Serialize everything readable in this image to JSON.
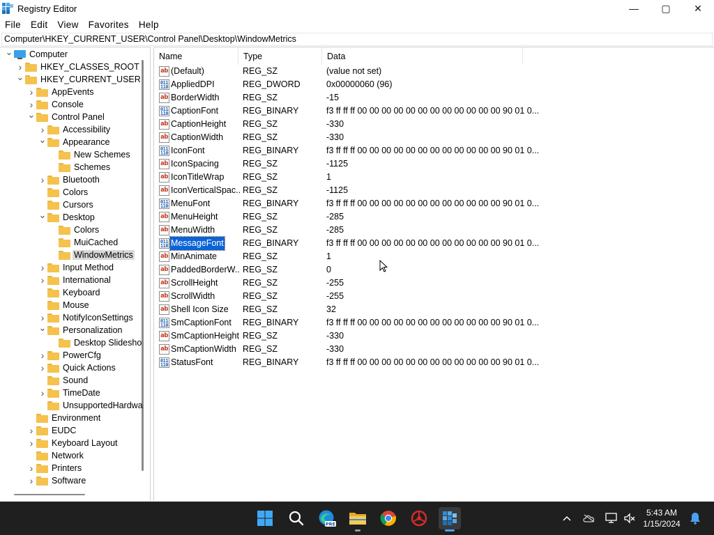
{
  "window": {
    "title": "Registry Editor",
    "controls": {
      "minimize": "—",
      "maximize": "▢",
      "close": "✕"
    }
  },
  "menu": [
    "File",
    "Edit",
    "View",
    "Favorites",
    "Help"
  ],
  "address": "Computer\\HKEY_CURRENT_USER\\Control Panel\\Desktop\\WindowMetrics",
  "tree": [
    {
      "label": "Computer",
      "depth": 0,
      "expander": "expanded",
      "icon": "computer-icon"
    },
    {
      "label": "HKEY_CLASSES_ROOT",
      "depth": 1,
      "expander": "collapsed"
    },
    {
      "label": "HKEY_CURRENT_USER",
      "depth": 1,
      "expander": "expanded"
    },
    {
      "label": "AppEvents",
      "depth": 2,
      "expander": "collapsed"
    },
    {
      "label": "Console",
      "depth": 2,
      "expander": "collapsed"
    },
    {
      "label": "Control Panel",
      "depth": 2,
      "expander": "expanded"
    },
    {
      "label": "Accessibility",
      "depth": 3,
      "expander": "collapsed"
    },
    {
      "label": "Appearance",
      "depth": 3,
      "expander": "expanded"
    },
    {
      "label": "New Schemes",
      "depth": 4,
      "expander": "none"
    },
    {
      "label": "Schemes",
      "depth": 4,
      "expander": "none"
    },
    {
      "label": "Bluetooth",
      "depth": 3,
      "expander": "collapsed"
    },
    {
      "label": "Colors",
      "depth": 3,
      "expander": "none"
    },
    {
      "label": "Cursors",
      "depth": 3,
      "expander": "none"
    },
    {
      "label": "Desktop",
      "depth": 3,
      "expander": "expanded"
    },
    {
      "label": "Colors",
      "depth": 4,
      "expander": "none"
    },
    {
      "label": "MuiCached",
      "depth": 4,
      "expander": "none"
    },
    {
      "label": "WindowMetrics",
      "depth": 4,
      "expander": "none",
      "selected": true
    },
    {
      "label": "Input Method",
      "depth": 3,
      "expander": "collapsed"
    },
    {
      "label": "International",
      "depth": 3,
      "expander": "collapsed"
    },
    {
      "label": "Keyboard",
      "depth": 3,
      "expander": "none"
    },
    {
      "label": "Mouse",
      "depth": 3,
      "expander": "none"
    },
    {
      "label": "NotifyIconSettings",
      "depth": 3,
      "expander": "collapsed"
    },
    {
      "label": "Personalization",
      "depth": 3,
      "expander": "expanded"
    },
    {
      "label": "Desktop Slidesho",
      "depth": 4,
      "expander": "none"
    },
    {
      "label": "PowerCfg",
      "depth": 3,
      "expander": "collapsed"
    },
    {
      "label": "Quick Actions",
      "depth": 3,
      "expander": "collapsed"
    },
    {
      "label": "Sound",
      "depth": 3,
      "expander": "none"
    },
    {
      "label": "TimeDate",
      "depth": 3,
      "expander": "collapsed"
    },
    {
      "label": "UnsupportedHardwa",
      "depth": 3,
      "expander": "none"
    },
    {
      "label": "Environment",
      "depth": 2,
      "expander": "none"
    },
    {
      "label": "EUDC",
      "depth": 2,
      "expander": "collapsed"
    },
    {
      "label": "Keyboard Layout",
      "depth": 2,
      "expander": "collapsed"
    },
    {
      "label": "Network",
      "depth": 2,
      "expander": "none"
    },
    {
      "label": "Printers",
      "depth": 2,
      "expander": "collapsed"
    },
    {
      "label": "Software",
      "depth": 2,
      "expander": "collapsed"
    }
  ],
  "columns": {
    "name": "Name",
    "type": "Type",
    "data": "Data"
  },
  "values": [
    {
      "name": "(Default)",
      "type": "REG_SZ",
      "data": "(value not set)",
      "kind": "string"
    },
    {
      "name": "AppliedDPI",
      "type": "REG_DWORD",
      "data": "0x00000060 (96)",
      "kind": "binary"
    },
    {
      "name": "BorderWidth",
      "type": "REG_SZ",
      "data": "-15",
      "kind": "string"
    },
    {
      "name": "CaptionFont",
      "type": "REG_BINARY",
      "data": "f3 ff ff ff 00 00 00 00 00 00 00 00 00 00 00 00 90 01 0...",
      "kind": "binary"
    },
    {
      "name": "CaptionHeight",
      "type": "REG_SZ",
      "data": "-330",
      "kind": "string"
    },
    {
      "name": "CaptionWidth",
      "type": "REG_SZ",
      "data": "-330",
      "kind": "string"
    },
    {
      "name": "IconFont",
      "type": "REG_BINARY",
      "data": "f3 ff ff ff 00 00 00 00 00 00 00 00 00 00 00 00 90 01 0...",
      "kind": "binary"
    },
    {
      "name": "IconSpacing",
      "type": "REG_SZ",
      "data": "-1125",
      "kind": "string"
    },
    {
      "name": "IconTitleWrap",
      "type": "REG_SZ",
      "data": "1",
      "kind": "string"
    },
    {
      "name": "IconVerticalSpac...",
      "type": "REG_SZ",
      "data": "-1125",
      "kind": "string"
    },
    {
      "name": "MenuFont",
      "type": "REG_BINARY",
      "data": "f3 ff ff ff 00 00 00 00 00 00 00 00 00 00 00 00 90 01 0...",
      "kind": "binary"
    },
    {
      "name": "MenuHeight",
      "type": "REG_SZ",
      "data": "-285",
      "kind": "string"
    },
    {
      "name": "MenuWidth",
      "type": "REG_SZ",
      "data": "-285",
      "kind": "string"
    },
    {
      "name": "MessageFont",
      "type": "REG_BINARY",
      "data": "f3 ff ff ff 00 00 00 00 00 00 00 00 00 00 00 00 90 01 0...",
      "kind": "binary",
      "selected": true
    },
    {
      "name": "MinAnimate",
      "type": "REG_SZ",
      "data": "1",
      "kind": "string"
    },
    {
      "name": "PaddedBorderW...",
      "type": "REG_SZ",
      "data": "0",
      "kind": "string"
    },
    {
      "name": "ScrollHeight",
      "type": "REG_SZ",
      "data": "-255",
      "kind": "string"
    },
    {
      "name": "ScrollWidth",
      "type": "REG_SZ",
      "data": "-255",
      "kind": "string"
    },
    {
      "name": "Shell Icon Size",
      "type": "REG_SZ",
      "data": "32",
      "kind": "string"
    },
    {
      "name": "SmCaptionFont",
      "type": "REG_BINARY",
      "data": "f3 ff ff ff 00 00 00 00 00 00 00 00 00 00 00 00 90 01 0...",
      "kind": "binary"
    },
    {
      "name": "SmCaptionHeight",
      "type": "REG_SZ",
      "data": "-330",
      "kind": "string"
    },
    {
      "name": "SmCaptionWidth",
      "type": "REG_SZ",
      "data": "-330",
      "kind": "string"
    },
    {
      "name": "StatusFont",
      "type": "REG_BINARY",
      "data": "f3 ff ff ff 00 00 00 00 00 00 00 00 00 00 00 00 90 01 0...",
      "kind": "binary"
    }
  ],
  "icon_text": {
    "string": "ab",
    "binary": "011\n110"
  },
  "taskbar": {
    "apps": [
      {
        "name": "start-icon",
        "active": false,
        "running": false
      },
      {
        "name": "search-icon",
        "active": false,
        "running": false
      },
      {
        "name": "edge-pre-icon",
        "active": false,
        "running": false,
        "badge": "PRE"
      },
      {
        "name": "file-explorer-icon",
        "active": false,
        "running": true
      },
      {
        "name": "chrome-icon",
        "active": false,
        "running": false
      },
      {
        "name": "davinci-resolve-icon",
        "active": false,
        "running": false
      },
      {
        "name": "registry-editor-icon",
        "active": true,
        "running": true
      }
    ],
    "tray": [
      "chevron-up-icon",
      "cloud-icon",
      "network-icon",
      "volume-muted-icon",
      "notification-bell-icon"
    ],
    "time": "5:43 AM",
    "date": "1/15/2024"
  },
  "colors": {
    "selection": "#0a64d6",
    "taskbar": "#1f1f1f",
    "folder": "#f4c24d",
    "accent": "#4aa0f0"
  }
}
